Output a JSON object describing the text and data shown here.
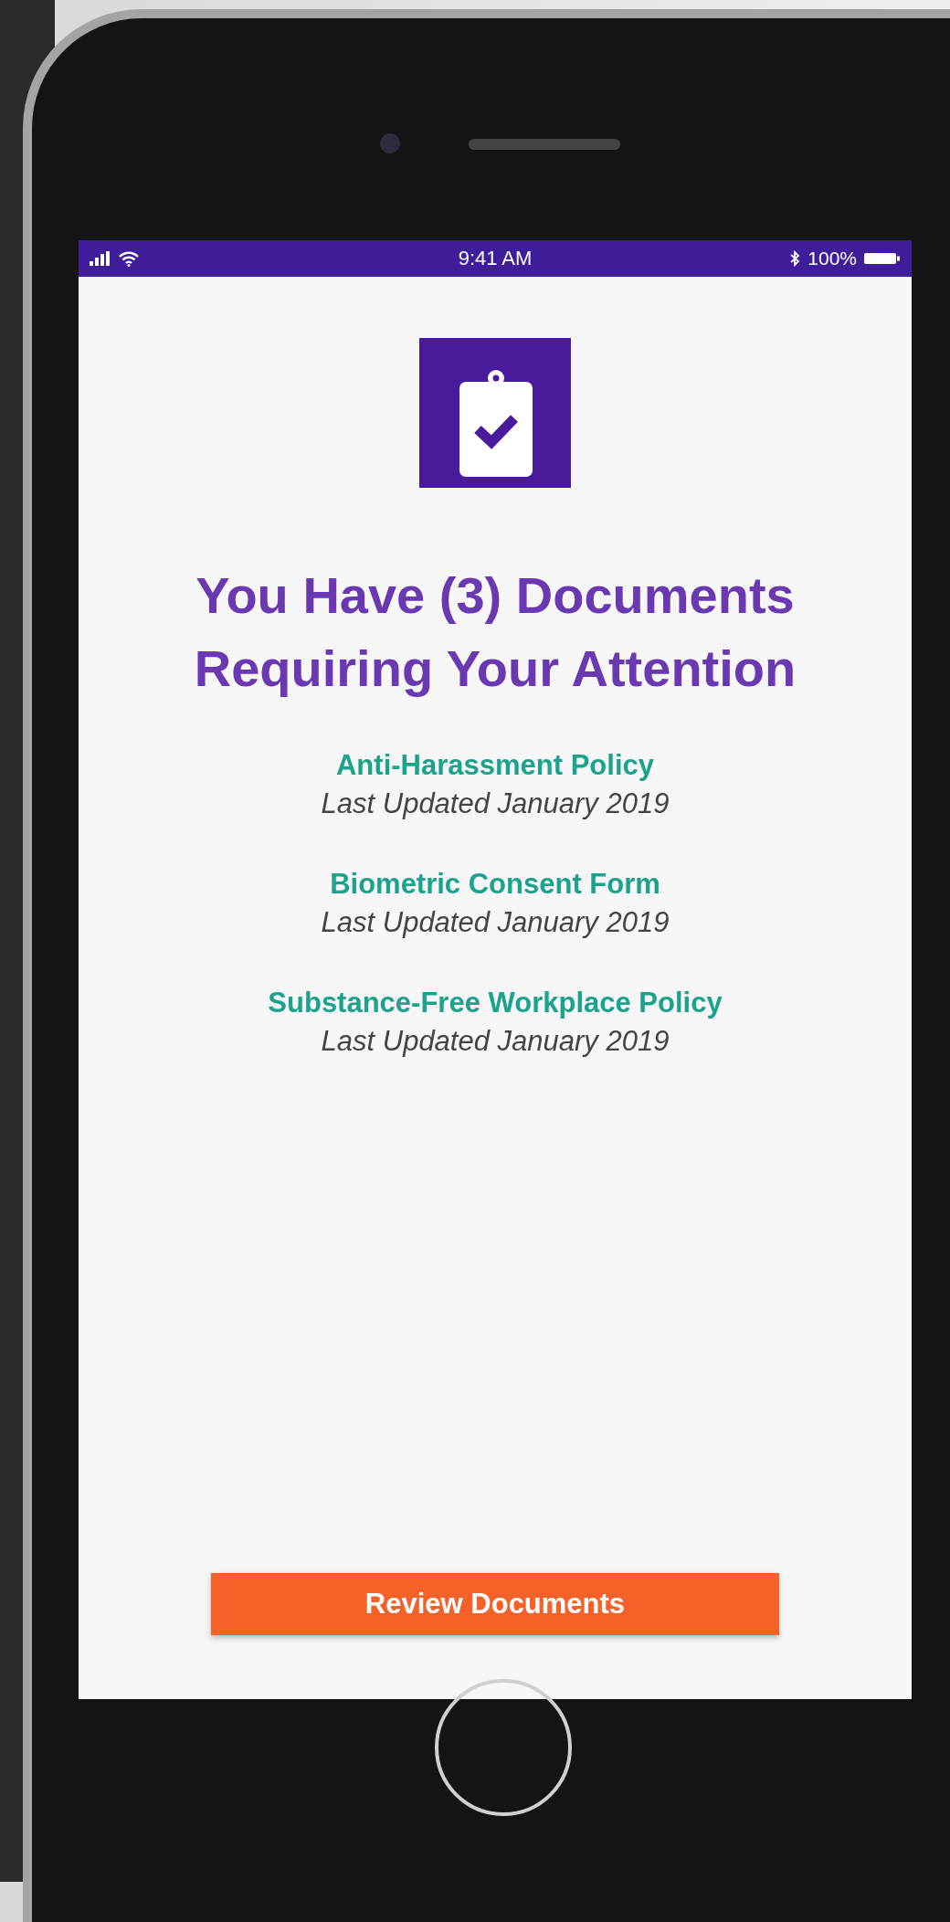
{
  "status_bar": {
    "time": "9:41 AM",
    "battery": "100%"
  },
  "heading": "You Have (3) Documents Requiring Your Attention",
  "documents": [
    {
      "title": "Anti-Harassment Policy",
      "updated": "Last Updated January 2019"
    },
    {
      "title": "Biometric Consent Form",
      "updated": "Last Updated January 2019"
    },
    {
      "title": "Substance-Free Workplace Policy",
      "updated": "Last Updated January 2019"
    }
  ],
  "button": "Review Documents"
}
